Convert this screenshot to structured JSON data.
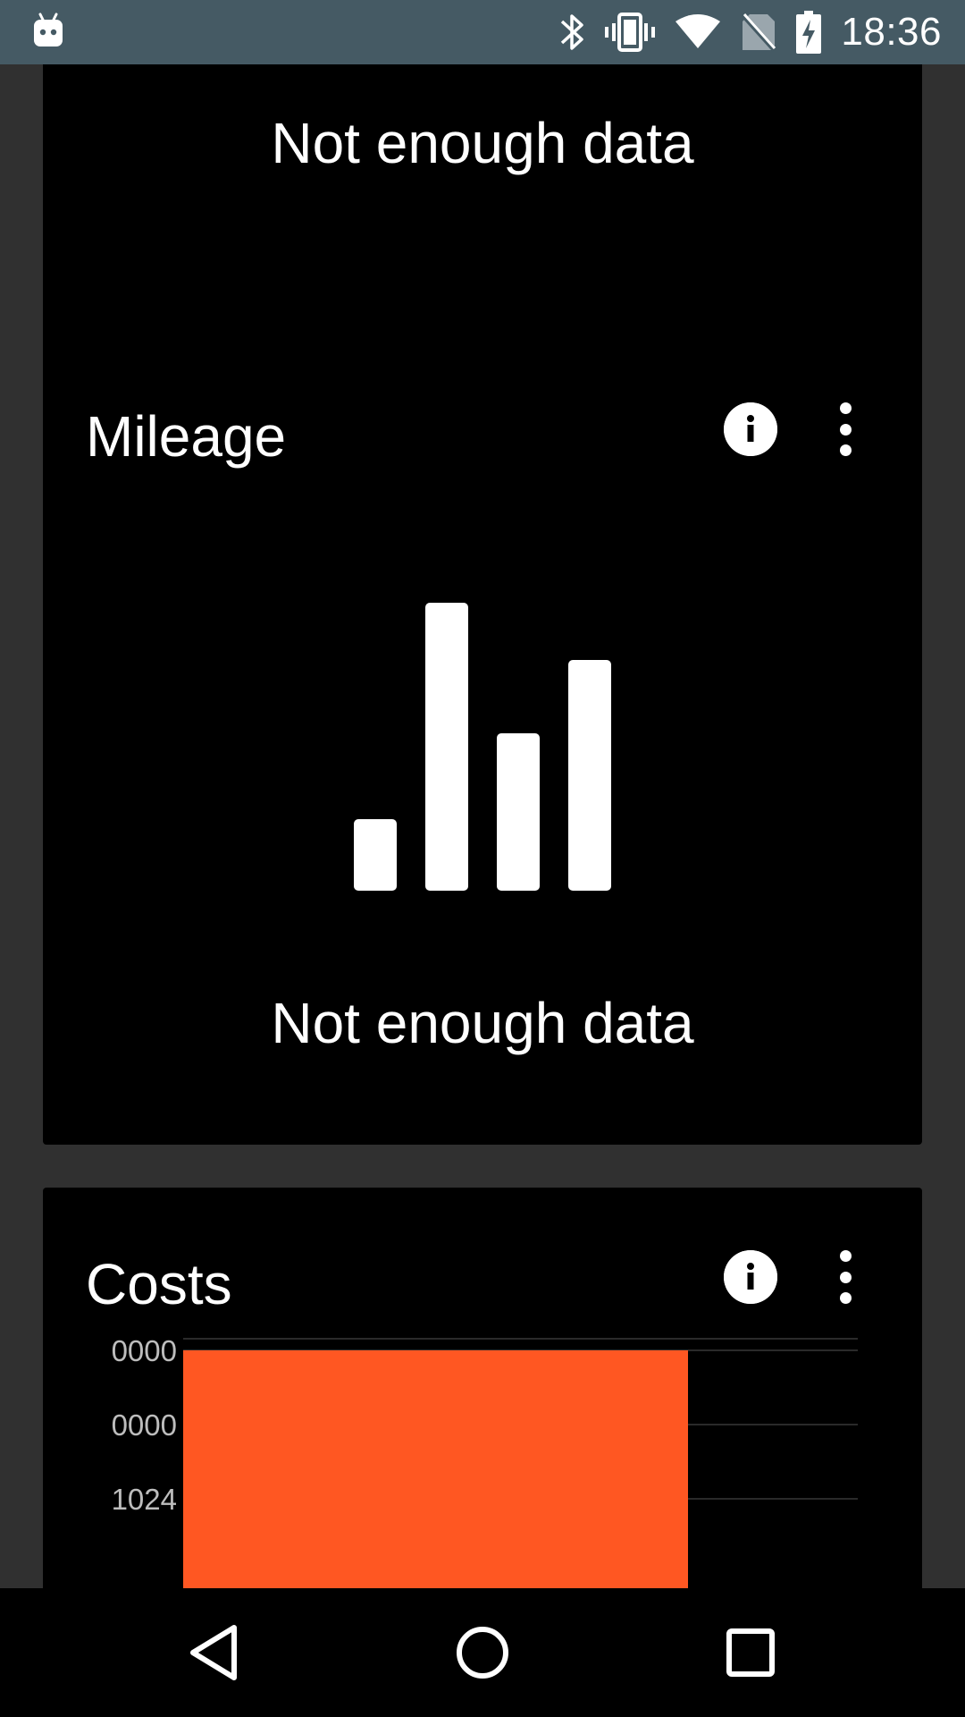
{
  "status_bar": {
    "time": "18:36",
    "icons": [
      "android-debug-icon",
      "bluetooth-icon",
      "vibrate-icon",
      "wifi-icon",
      "no-sim-icon",
      "battery-charging-icon"
    ]
  },
  "cards": {
    "top": {
      "empty_text": "Not enough data"
    },
    "mileage": {
      "title": "Mileage",
      "empty_text": "Not enough data",
      "icons": [
        "info-icon",
        "more-vert-icon",
        "bar-chart-icon"
      ]
    },
    "costs": {
      "title": "Costs",
      "icons": [
        "info-icon",
        "more-vert-icon"
      ]
    }
  },
  "colors": {
    "status_bar": "#455a64",
    "background": "#303030",
    "card": "#000000",
    "bar": "#ff5722",
    "gridline": "#2a2a2a",
    "tick_label": "#bdbdbd"
  },
  "chart_data": {
    "type": "bar",
    "tick_labels": [
      "0000",
      "0000",
      "1024"
    ],
    "ticks": [
      3072,
      2048,
      1024
    ],
    "categories": [
      ""
    ],
    "values": [
      3072
    ],
    "ylim": [
      0,
      3500
    ],
    "visible_range": [
      900,
      3080
    ],
    "grid": true,
    "title": "",
    "xlabel": "",
    "ylabel": ""
  },
  "nav_bar": {
    "icons": [
      "back-icon",
      "home-icon",
      "recents-icon"
    ]
  }
}
